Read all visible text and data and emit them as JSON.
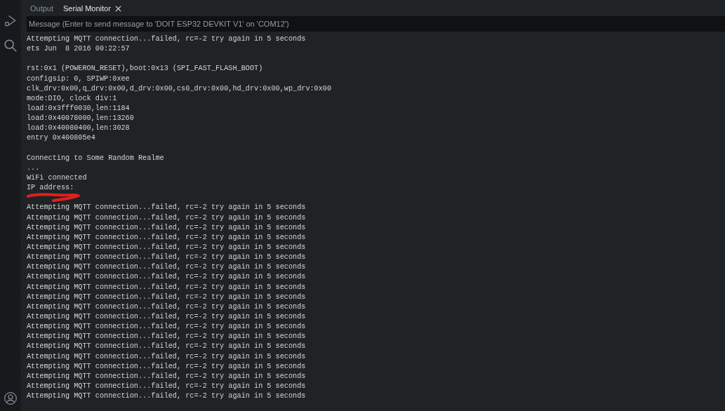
{
  "tabs": [
    {
      "label": "Output",
      "selected": false,
      "closable": false
    },
    {
      "label": "Serial Monitor",
      "selected": true,
      "closable": true
    }
  ],
  "message_field": {
    "placeholder": "Message (Enter to send message to 'DOIT ESP32 DEVKIT V1' on 'COM12')"
  },
  "log": [
    {
      "kind": "text",
      "text": "Attempting MQTT connection...failed, rc=-2 try again in 5 seconds"
    },
    {
      "kind": "text",
      "text": "ets Jun  8 2016 00:22:57"
    },
    {
      "kind": "blank"
    },
    {
      "kind": "text",
      "text": "rst:0x1 (POWERON_RESET),boot:0x13 (SPI_FAST_FLASH_BOOT)"
    },
    {
      "kind": "text",
      "text": "configsip: 0, SPIWP:0xee"
    },
    {
      "kind": "text",
      "text": "clk_drv:0x00,q_drv:0x00,d_drv:0x00,cs0_drv:0x00,hd_drv:0x00,wp_drv:0x00"
    },
    {
      "kind": "text",
      "text": "mode:DIO, clock div:1"
    },
    {
      "kind": "text",
      "text": "load:0x3fff0030,len:1184"
    },
    {
      "kind": "text",
      "text": "load:0x40078000,len:13260"
    },
    {
      "kind": "text",
      "text": "load:0x40080400,len:3028"
    },
    {
      "kind": "text",
      "text": "entry 0x400805e4"
    },
    {
      "kind": "blank"
    },
    {
      "kind": "text",
      "text": "Connecting to Some Random Realme"
    },
    {
      "kind": "text",
      "text": "..."
    },
    {
      "kind": "text",
      "text": "WiFi connected"
    },
    {
      "kind": "text",
      "text": "IP address:"
    },
    {
      "kind": "redacted"
    },
    {
      "kind": "text",
      "text": "Attempting MQTT connection...failed, rc=-2 try again in 5 seconds"
    },
    {
      "kind": "text",
      "text": "Attempting MQTT connection...failed, rc=-2 try again in 5 seconds"
    },
    {
      "kind": "text",
      "text": "Attempting MQTT connection...failed, rc=-2 try again in 5 seconds"
    },
    {
      "kind": "text",
      "text": "Attempting MQTT connection...failed, rc=-2 try again in 5 seconds"
    },
    {
      "kind": "text",
      "text": "Attempting MQTT connection...failed, rc=-2 try again in 5 seconds"
    },
    {
      "kind": "text",
      "text": "Attempting MQTT connection...failed, rc=-2 try again in 5 seconds"
    },
    {
      "kind": "text",
      "text": "Attempting MQTT connection...failed, rc=-2 try again in 5 seconds"
    },
    {
      "kind": "text",
      "text": "Attempting MQTT connection...failed, rc=-2 try again in 5 seconds"
    },
    {
      "kind": "text",
      "text": "Attempting MQTT connection...failed, rc=-2 try again in 5 seconds"
    },
    {
      "kind": "text",
      "text": "Attempting MQTT connection...failed, rc=-2 try again in 5 seconds"
    },
    {
      "kind": "text",
      "text": "Attempting MQTT connection...failed, rc=-2 try again in 5 seconds"
    },
    {
      "kind": "text",
      "text": "Attempting MQTT connection...failed, rc=-2 try again in 5 seconds"
    },
    {
      "kind": "text",
      "text": "Attempting MQTT connection...failed, rc=-2 try again in 5 seconds"
    },
    {
      "kind": "text",
      "text": "Attempting MQTT connection...failed, rc=-2 try again in 5 seconds"
    },
    {
      "kind": "text",
      "text": "Attempting MQTT connection...failed, rc=-2 try again in 5 seconds"
    },
    {
      "kind": "text",
      "text": "Attempting MQTT connection...failed, rc=-2 try again in 5 seconds"
    },
    {
      "kind": "text",
      "text": "Attempting MQTT connection...failed, rc=-2 try again in 5 seconds"
    },
    {
      "kind": "text",
      "text": "Attempting MQTT connection...failed, rc=-2 try again in 5 seconds"
    },
    {
      "kind": "text",
      "text": "Attempting MQTT connection...failed, rc=-2 try again in 5 seconds"
    },
    {
      "kind": "text",
      "text": "Attempting MQTT connection...failed, rc=-2 try again in 5 seconds"
    }
  ]
}
